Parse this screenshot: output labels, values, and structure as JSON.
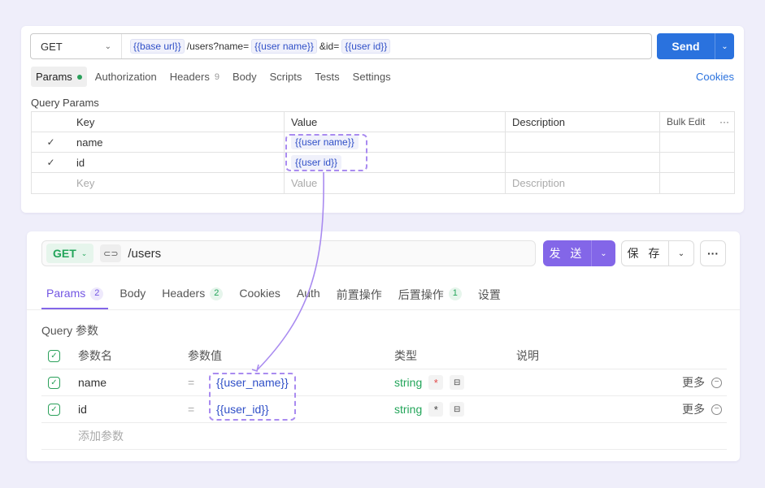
{
  "postman": {
    "method": "GET",
    "url_parts": [
      {
        "kind": "var",
        "text": "{{base url}}"
      },
      {
        "kind": "text",
        "text": "/users?name="
      },
      {
        "kind": "var",
        "text": "{{user name}}"
      },
      {
        "kind": "text",
        "text": "&id="
      },
      {
        "kind": "var",
        "text": "{{user id}}"
      }
    ],
    "send_label": "Send",
    "tabs": [
      {
        "label": "Params",
        "dot": true
      },
      {
        "label": "Authorization"
      },
      {
        "label": "Headers",
        "count": "9"
      },
      {
        "label": "Body"
      },
      {
        "label": "Scripts"
      },
      {
        "label": "Tests"
      },
      {
        "label": "Settings"
      }
    ],
    "cookies_label": "Cookies",
    "query_title": "Query Params",
    "columns": {
      "key": "Key",
      "value": "Value",
      "description": "Description",
      "bulk_edit": "Bulk Edit"
    },
    "rows": [
      {
        "key": "name",
        "value": "{{user name}}"
      },
      {
        "key": "id",
        "value": "{{user id}}"
      }
    ],
    "placeholders": {
      "key": "Key",
      "value": "Value",
      "description": "Description"
    }
  },
  "apifox": {
    "method": "GET",
    "path": "/users",
    "send_label": "发 送",
    "save_label": "保 存",
    "tabs": [
      {
        "label": "Params",
        "count": "2",
        "active": true
      },
      {
        "label": "Body"
      },
      {
        "label": "Headers",
        "count": "2"
      },
      {
        "label": "Cookies"
      },
      {
        "label": "Auth"
      },
      {
        "label": "前置操作"
      },
      {
        "label": "后置操作",
        "count": "1"
      },
      {
        "label": "设置"
      }
    ],
    "query_title": "Query 参数",
    "columns": {
      "name": "参数名",
      "value": "参数值",
      "type": "类型",
      "description": "说明"
    },
    "rows": [
      {
        "name": "name",
        "value": "{{user_name}}",
        "type": "string",
        "required": true,
        "more": "更多"
      },
      {
        "name": "id",
        "value": "{{user_id}}",
        "type": "string",
        "required": false,
        "more": "更多"
      }
    ],
    "add_placeholder": "添加参数"
  },
  "colors": {
    "accent_blue": "#2a72de",
    "accent_purple": "#8366e8",
    "green": "#23a55a",
    "arrow": "#a98bf0"
  }
}
